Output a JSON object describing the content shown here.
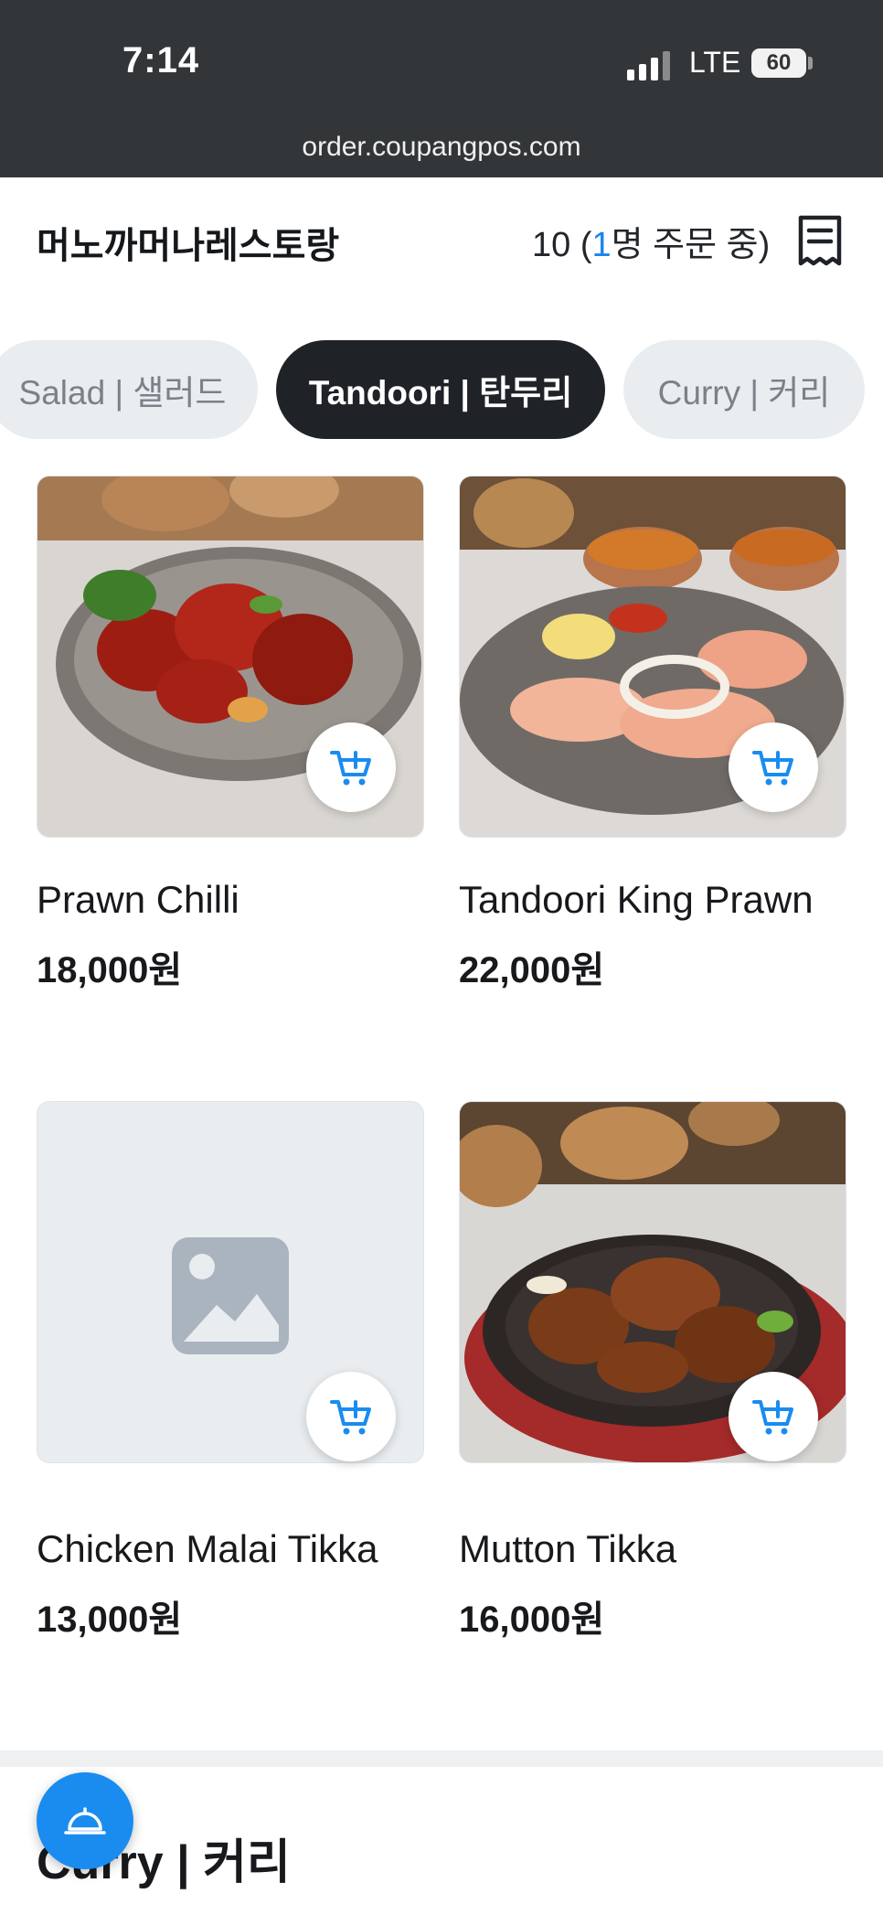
{
  "status_bar": {
    "time": "7:14",
    "carrier": "LTE",
    "battery": "60"
  },
  "browser": {
    "url": "order.coupangpos.com"
  },
  "header": {
    "store_name": "머노까머나레스토랑",
    "table_number": "10",
    "ordering_count": "1",
    "ordering_suffix": "명 주문 중)"
  },
  "tabs": [
    {
      "label": "Salad | 샐러드",
      "active": false
    },
    {
      "label": "Tandoori | 탄두리",
      "active": true
    },
    {
      "label": "Curry | 커리",
      "active": false
    }
  ],
  "menu_items": [
    {
      "name": "Prawn Chilli",
      "price": "18,000원",
      "image": "prawn-chilli-photo"
    },
    {
      "name": "Tandoori King Prawn",
      "price": "22,000원",
      "image": "tandoori-king-prawn-photo"
    },
    {
      "name": "Chicken Malai Tikka",
      "price": "13,000원",
      "image": "placeholder-image-icon"
    },
    {
      "name": "Mutton Tikka",
      "price": "16,000원",
      "image": "mutton-tikka-photo"
    }
  ],
  "next_section": {
    "title": "Curry | 커리"
  },
  "colors": {
    "accent": "#1a8cf0",
    "active_tab": "#1f2328",
    "status_bar": "#333638"
  },
  "icons": {
    "cart": "add-to-cart-icon",
    "receipt": "receipt-icon",
    "fab": "call-bell-icon"
  }
}
